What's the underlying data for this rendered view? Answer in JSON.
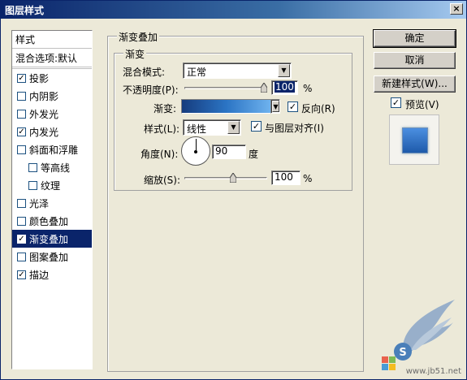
{
  "window": {
    "title": "图层样式",
    "close": "×"
  },
  "style_list": {
    "header": "样式",
    "blend_default": "混合选项:默认",
    "items": [
      {
        "label": "投影",
        "checked": true
      },
      {
        "label": "内阴影",
        "checked": false
      },
      {
        "label": "外发光",
        "checked": false
      },
      {
        "label": "内发光",
        "checked": true
      },
      {
        "label": "斜面和浮雕",
        "checked": false
      },
      {
        "label": "等高线",
        "checked": false
      },
      {
        "label": "纹理",
        "checked": false
      },
      {
        "label": "光泽",
        "checked": false
      },
      {
        "label": "颜色叠加",
        "checked": false
      },
      {
        "label": "渐变叠加",
        "checked": true
      },
      {
        "label": "图案叠加",
        "checked": false
      },
      {
        "label": "描边",
        "checked": true
      }
    ]
  },
  "panel": {
    "group_title": "渐变叠加",
    "sub_title": "渐变",
    "blend_mode_label": "混合模式:",
    "blend_mode_value": "正常",
    "opacity_label": "不透明度(P):",
    "opacity_value": "100",
    "opacity_fraction": 1.0,
    "opacity_unit": "%",
    "gradient_label": "渐变:",
    "reverse_label": "反向(R)",
    "reverse_checked": true,
    "style_label": "样式(L):",
    "style_value": "线性",
    "align_label": "与图层对齐(I)",
    "align_checked": true,
    "angle_label": "角度(N):",
    "angle_value": "90",
    "angle_unit": "度",
    "scale_label": "缩放(S):",
    "scale_value": "100",
    "scale_fraction": 0.6,
    "scale_unit": "%"
  },
  "buttons": {
    "ok": "确定",
    "cancel": "取消",
    "new_style": "新建样式(W)...",
    "preview_label": "预览(V)",
    "preview_checked": true
  },
  "watermark": {
    "text": "www.jb51.net",
    "icon": "wing-logo-icon"
  },
  "colors": {
    "selection": "#0a246a",
    "gradient_start": "#163c7e",
    "gradient_end": "#6eb2ee"
  }
}
